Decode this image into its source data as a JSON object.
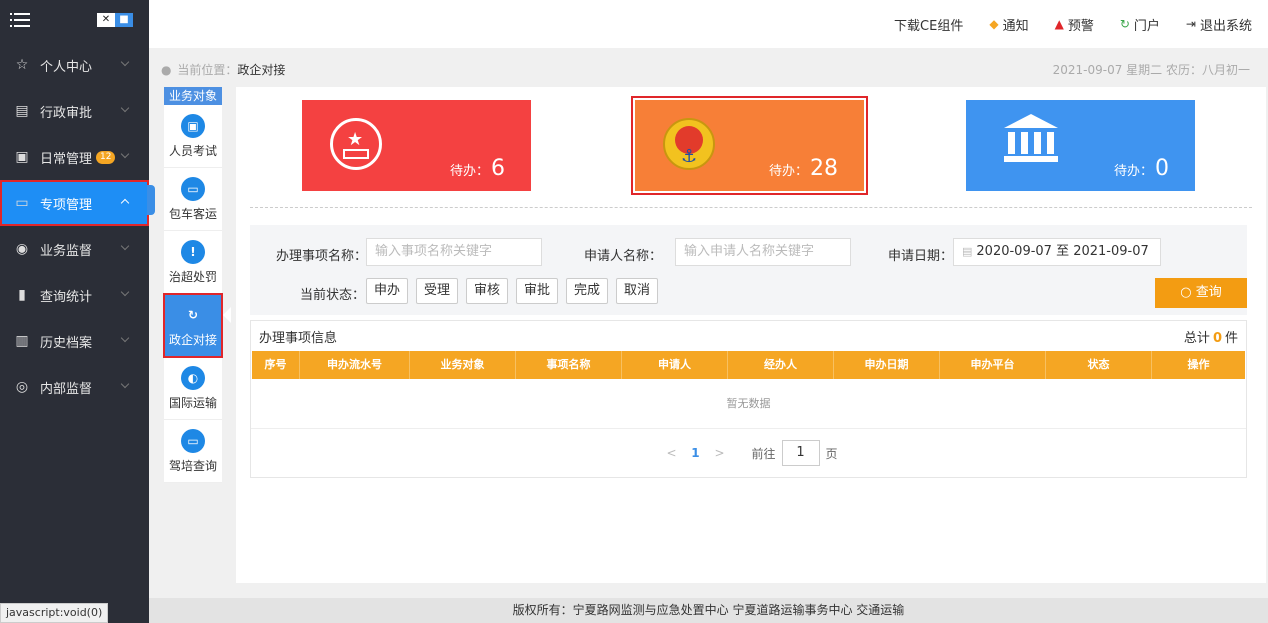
{
  "header": {
    "download": "下载CE组件",
    "notice": "通知",
    "warning": "预警",
    "portal": "门户",
    "logout": "退出系统"
  },
  "sidebar": {
    "items": [
      {
        "label": "个人中心",
        "icon": "star-icon"
      },
      {
        "label": "行政审批",
        "icon": "document-icon"
      },
      {
        "label": "日常管理",
        "icon": "calendar-icon",
        "badge": "12"
      },
      {
        "label": "专项管理",
        "icon": "folder-icon"
      },
      {
        "label": "业务监督",
        "icon": "eye-icon"
      },
      {
        "label": "查询统计",
        "icon": "bar-chart-icon"
      },
      {
        "label": "历史档案",
        "icon": "archive-icon"
      },
      {
        "label": "内部监督",
        "icon": "target-icon"
      }
    ]
  },
  "breadcrumb": {
    "label": "当前位置：",
    "current": "政企对接",
    "date": "2021-09-07 星期二 农历：八月初一"
  },
  "objnav": {
    "title": "业务对象",
    "items": [
      {
        "label": "人员考试"
      },
      {
        "label": "包车客运"
      },
      {
        "label": "治超处罚"
      },
      {
        "label": "政企对接"
      },
      {
        "label": "国际运输"
      },
      {
        "label": "驾培查询"
      }
    ]
  },
  "cards": [
    {
      "pending_label": "待办：",
      "count": "6"
    },
    {
      "pending_label": "待办：",
      "count": "28"
    },
    {
      "pending_label": "待办：",
      "count": "0"
    }
  ],
  "filter": {
    "item_name_label": "办理事项名称：",
    "item_name_placeholder": "输入事项名称关键字",
    "applicant_label": "申请人名称：",
    "applicant_placeholder": "输入申请人名称关键字",
    "date_label": "申请日期：",
    "date_value": "2020-09-07 至 2021-09-07",
    "status_label": "当前状态：",
    "statuses": [
      "申办",
      "受理",
      "审核",
      "审批",
      "完成",
      "取消"
    ],
    "query_button": "查询"
  },
  "table": {
    "title": "办理事项信息",
    "total_prefix": "总计",
    "total_count": "0",
    "total_suffix": "件",
    "columns": [
      "序号",
      "申办流水号",
      "业务对象",
      "事项名称",
      "申请人",
      "经办人",
      "申办日期",
      "申办平台",
      "状态",
      "操作"
    ],
    "empty_text": "暂无数据"
  },
  "pager": {
    "current_page": "1",
    "goto_prefix": "前往",
    "goto_value": "1",
    "goto_suffix": "页"
  },
  "footer": "版权所有：宁夏路网监测与应急处置中心 宁夏道路运输事务中心 交通运输",
  "status_bar": "javascript:void(0)"
}
